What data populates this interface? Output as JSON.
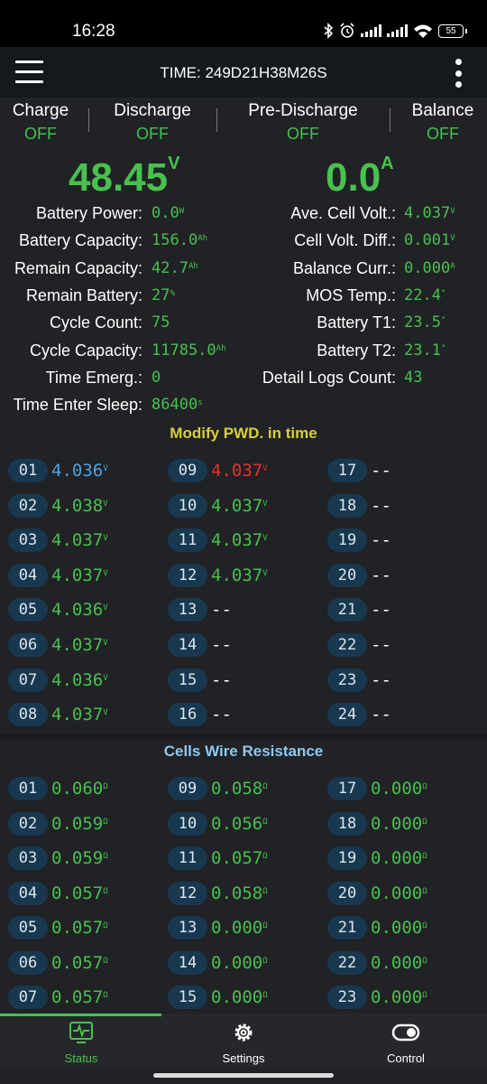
{
  "status_bar": {
    "time": "16:28",
    "battery": "55"
  },
  "app_bar": {
    "title": "TIME: 249D21H38M26S"
  },
  "switches": [
    {
      "label": "Charge",
      "value": "OFF"
    },
    {
      "label": "Discharge",
      "value": "OFF"
    },
    {
      "label": "Pre-Discharge",
      "value": "OFF"
    },
    {
      "label": "Balance",
      "value": "OFF"
    }
  ],
  "main": {
    "voltage": {
      "value": "48.45",
      "unit": "V"
    },
    "current": {
      "value": "0.0",
      "unit": "A"
    }
  },
  "left_info": [
    {
      "label": "Battery Power:",
      "value": "0.0",
      "unit": "W"
    },
    {
      "label": "Battery Capacity:",
      "value": "156.0",
      "unit": "Ah"
    },
    {
      "label": "Remain Capacity:",
      "value": "42.7",
      "unit": "Ah"
    },
    {
      "label": "Remain Battery:",
      "value": "27",
      "unit": "%"
    },
    {
      "label": "Cycle Count:",
      "value": "75",
      "unit": ""
    },
    {
      "label": "Cycle Capacity:",
      "value": "11785.0",
      "unit": "Ah"
    },
    {
      "label": "Time Emerg.:",
      "value": "0",
      "unit": ""
    },
    {
      "label": "Time Enter Sleep:",
      "value": "86400",
      "unit": "s"
    }
  ],
  "right_info": [
    {
      "label": "Ave. Cell Volt.:",
      "value": "4.037",
      "unit": "V"
    },
    {
      "label": "Cell Volt. Diff.:",
      "value": "0.001",
      "unit": "V"
    },
    {
      "label": "Balance Curr.:",
      "value": "0.000",
      "unit": "A"
    },
    {
      "label": "MOS Temp.:",
      "value": "22.4",
      "unit": "°"
    },
    {
      "label": "Battery T1:",
      "value": "23.5",
      "unit": "°"
    },
    {
      "label": "Battery T2:",
      "value": "23.1",
      "unit": "°"
    },
    {
      "label": "Detail Logs Count:",
      "value": "43",
      "unit": ""
    }
  ],
  "sections": {
    "modify_pwd": "Modify PWD. in time",
    "wire_resistance": "Cells Wire Resistance"
  },
  "colors": {
    "accent": "#48c14f",
    "min_cell": "#4aa3e8",
    "max_cell": "#e8302a",
    "section_yellow": "#d8cf3a",
    "section_blue": "#8fc8f0",
    "badge": "#18384f"
  },
  "cell_voltages": [
    {
      "id": "01",
      "value": "4.036",
      "unit": "V",
      "state": "min"
    },
    {
      "id": "02",
      "value": "4.038",
      "unit": "V",
      "state": ""
    },
    {
      "id": "03",
      "value": "4.037",
      "unit": "V",
      "state": ""
    },
    {
      "id": "04",
      "value": "4.037",
      "unit": "V",
      "state": ""
    },
    {
      "id": "05",
      "value": "4.036",
      "unit": "V",
      "state": ""
    },
    {
      "id": "06",
      "value": "4.037",
      "unit": "V",
      "state": ""
    },
    {
      "id": "07",
      "value": "4.036",
      "unit": "V",
      "state": ""
    },
    {
      "id": "08",
      "value": "4.037",
      "unit": "V",
      "state": ""
    },
    {
      "id": "09",
      "value": "4.037",
      "unit": "V",
      "state": "max"
    },
    {
      "id": "10",
      "value": "4.037",
      "unit": "V",
      "state": ""
    },
    {
      "id": "11",
      "value": "4.037",
      "unit": "V",
      "state": ""
    },
    {
      "id": "12",
      "value": "4.037",
      "unit": "V",
      "state": ""
    },
    {
      "id": "13",
      "value": "--",
      "unit": "",
      "state": "empty"
    },
    {
      "id": "14",
      "value": "--",
      "unit": "",
      "state": "empty"
    },
    {
      "id": "15",
      "value": "--",
      "unit": "",
      "state": "empty"
    },
    {
      "id": "16",
      "value": "--",
      "unit": "",
      "state": "empty"
    },
    {
      "id": "17",
      "value": "--",
      "unit": "",
      "state": "empty"
    },
    {
      "id": "18",
      "value": "--",
      "unit": "",
      "state": "empty"
    },
    {
      "id": "19",
      "value": "--",
      "unit": "",
      "state": "empty"
    },
    {
      "id": "20",
      "value": "--",
      "unit": "",
      "state": "empty"
    },
    {
      "id": "21",
      "value": "--",
      "unit": "",
      "state": "empty"
    },
    {
      "id": "22",
      "value": "--",
      "unit": "",
      "state": "empty"
    },
    {
      "id": "23",
      "value": "--",
      "unit": "",
      "state": "empty"
    },
    {
      "id": "24",
      "value": "--",
      "unit": "",
      "state": "empty"
    }
  ],
  "wire_resistance": [
    {
      "id": "01",
      "value": "0.060",
      "unit": "Ω"
    },
    {
      "id": "02",
      "value": "0.059",
      "unit": "Ω"
    },
    {
      "id": "03",
      "value": "0.059",
      "unit": "Ω"
    },
    {
      "id": "04",
      "value": "0.057",
      "unit": "Ω"
    },
    {
      "id": "05",
      "value": "0.057",
      "unit": "Ω"
    },
    {
      "id": "06",
      "value": "0.057",
      "unit": "Ω"
    },
    {
      "id": "07",
      "value": "0.057",
      "unit": "Ω"
    },
    {
      "id": "09",
      "value": "0.058",
      "unit": "Ω"
    },
    {
      "id": "10",
      "value": "0.056",
      "unit": "Ω"
    },
    {
      "id": "11",
      "value": "0.057",
      "unit": "Ω"
    },
    {
      "id": "12",
      "value": "0.058",
      "unit": "Ω"
    },
    {
      "id": "13",
      "value": "0.000",
      "unit": "Ω"
    },
    {
      "id": "14",
      "value": "0.000",
      "unit": "Ω"
    },
    {
      "id": "15",
      "value": "0.000",
      "unit": "Ω"
    },
    {
      "id": "17",
      "value": "0.000",
      "unit": "Ω"
    },
    {
      "id": "18",
      "value": "0.000",
      "unit": "Ω"
    },
    {
      "id": "19",
      "value": "0.000",
      "unit": "Ω"
    },
    {
      "id": "20",
      "value": "0.000",
      "unit": "Ω"
    },
    {
      "id": "21",
      "value": "0.000",
      "unit": "Ω"
    },
    {
      "id": "22",
      "value": "0.000",
      "unit": "Ω"
    },
    {
      "id": "23",
      "value": "0.000",
      "unit": "Ω"
    }
  ],
  "bottom_nav": [
    {
      "label": "Status",
      "icon": "pulse-monitor-icon",
      "active": true
    },
    {
      "label": "Settings",
      "icon": "gear-icon",
      "active": false
    },
    {
      "label": "Control",
      "icon": "toggle-icon",
      "active": false
    }
  ]
}
